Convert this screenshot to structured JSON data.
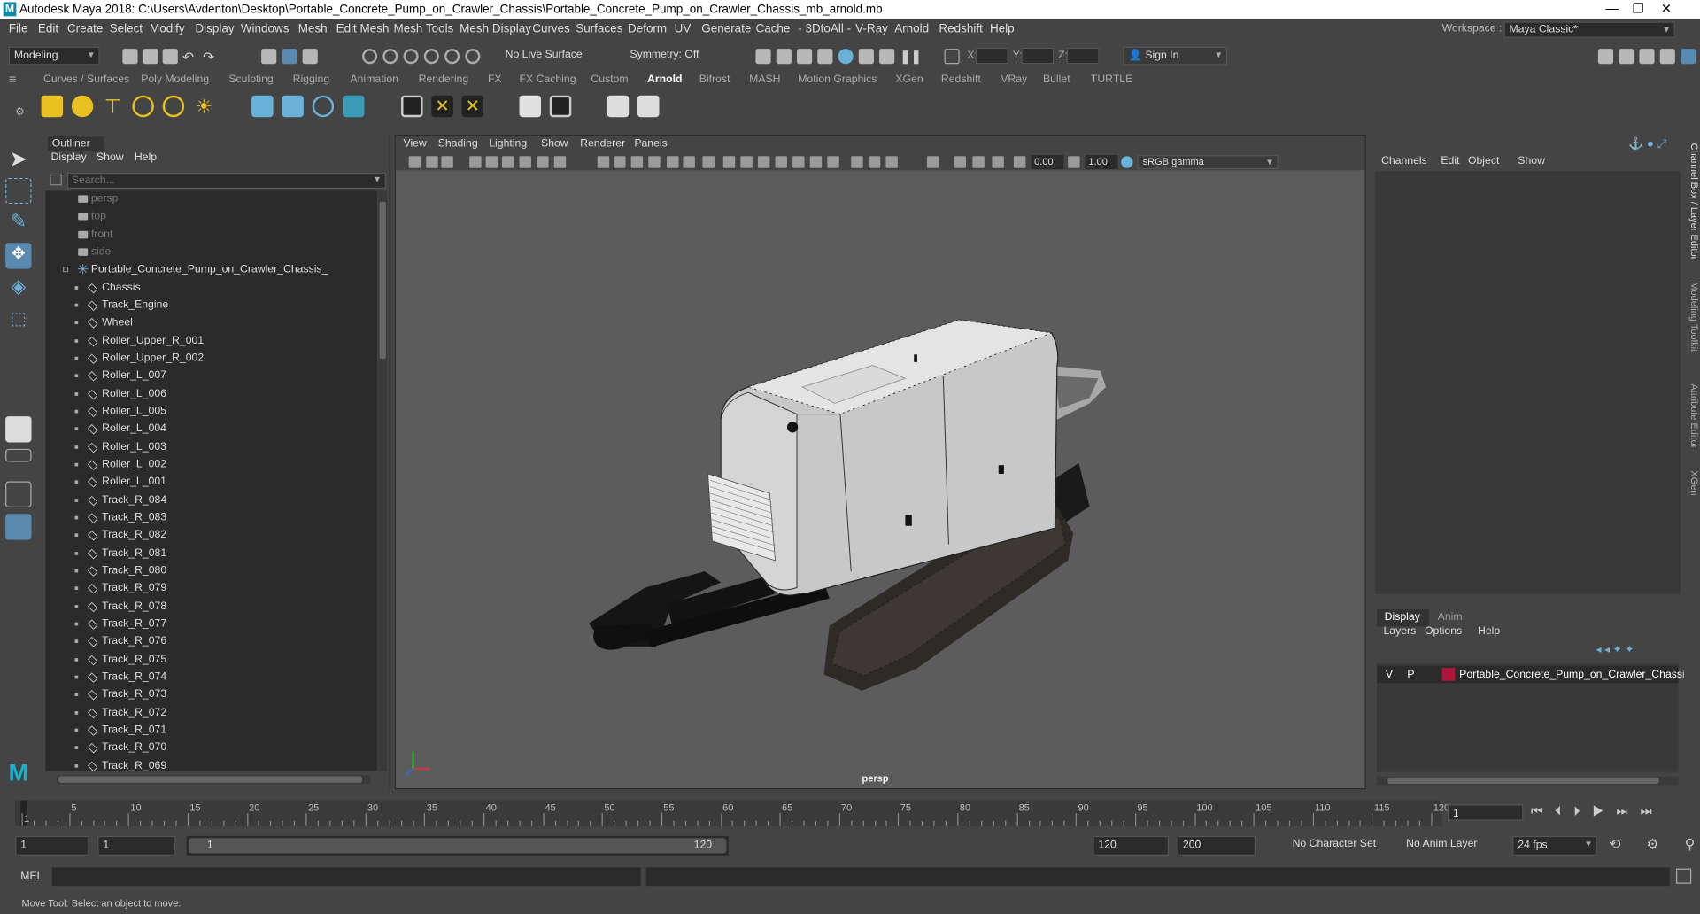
{
  "title_bar": {
    "title": "Autodesk Maya 2018: C:\\Users\\Avdenton\\Desktop\\Portable_Concrete_Pump_on_Crawler_Chassis\\Portable_Concrete_Pump_on_Crawler_Chassis_mb_arnold.mb",
    "minimize": "—",
    "maximize": "❐",
    "close": "✕"
  },
  "menu": [
    "File",
    "Edit",
    "Create",
    "Select",
    "Modify",
    "Display",
    "Windows",
    "Mesh",
    "Edit Mesh",
    "Mesh Tools",
    "Mesh Display",
    "Curves",
    "Surfaces",
    "Deform",
    "UV",
    "Generate",
    "Cache",
    "- 3DtoAll -",
    "V-Ray",
    "Arnold",
    "Redshift",
    "Help"
  ],
  "workspace": {
    "label": "Workspace :",
    "value": "Maya Classic*"
  },
  "status_line": {
    "mode": "Modeling",
    "live_surface": "No Live Surface",
    "symmetry": "Symmetry: Off",
    "x_label": "X:",
    "y_label": "Y:",
    "z_label": "Z:",
    "sign_in": "Sign In"
  },
  "shelf_tabs": [
    "Curves / Surfaces",
    "Poly Modeling",
    "Sculpting",
    "Rigging",
    "Animation",
    "Rendering",
    "FX",
    "FX Caching",
    "Custom",
    "Arnold",
    "Bifrost",
    "MASH",
    "Motion Graphics",
    "XGen",
    "Redshift",
    "VRay",
    "Bullet",
    "TURTLE"
  ],
  "shelf_active": "Arnold",
  "outliner": {
    "title": "Outliner",
    "menu": [
      "Display",
      "Show",
      "Help"
    ],
    "search_placeholder": "Search...",
    "cameras": [
      "persp",
      "top",
      "front",
      "side"
    ],
    "root": "Portable_Concrete_Pump_on_Crawler_Chassis_",
    "children": [
      "Chassis",
      "Track_Engine",
      "Wheel",
      "Roller_Upper_R_001",
      "Roller_Upper_R_002",
      "Roller_L_007",
      "Roller_L_006",
      "Roller_L_005",
      "Roller_L_004",
      "Roller_L_003",
      "Roller_L_002",
      "Roller_L_001",
      "Track_R_084",
      "Track_R_083",
      "Track_R_082",
      "Track_R_081",
      "Track_R_080",
      "Track_R_079",
      "Track_R_078",
      "Track_R_077",
      "Track_R_076",
      "Track_R_075",
      "Track_R_074",
      "Track_R_073",
      "Track_R_072",
      "Track_R_071",
      "Track_R_070",
      "Track_R_069"
    ]
  },
  "viewport": {
    "menu": [
      "View",
      "Shading",
      "Lighting",
      "Show",
      "Renderer",
      "Panels"
    ],
    "exposure": "0.00",
    "gamma": "1.00",
    "color_space": "sRGB gamma",
    "camera_label": "persp"
  },
  "channel_box": {
    "menu": [
      "Channels",
      "Edit",
      "Object",
      "Show"
    ],
    "tabs": [
      "Display",
      "Anim"
    ],
    "active_tab": "Display",
    "layer_menu": [
      "Layers",
      "Options",
      "Help"
    ],
    "layer": {
      "v": "V",
      "p": "P",
      "name": "Portable_Concrete_Pump_on_Crawler_Chassis",
      "color": "#b0143c"
    }
  },
  "side_tabs": [
    "Channel Box / Layer Editor",
    "Modeling Toolkit",
    "Attribute Editor",
    "XGen"
  ],
  "timeline": {
    "ticks": [
      "1",
      "5",
      "10",
      "15",
      "20",
      "25",
      "30",
      "35",
      "40",
      "45",
      "50",
      "55",
      "60",
      "65",
      "70",
      "75",
      "80",
      "85",
      "90",
      "95",
      "100",
      "105",
      "110",
      "115",
      "120"
    ],
    "current_frame": "1"
  },
  "range": {
    "start": "1",
    "anim_start": "1",
    "range_start": "1",
    "range_end": "120",
    "end": "120",
    "anim_end": "200",
    "character_set": "No Character Set",
    "anim_layer": "No Anim Layer",
    "fps": "24 fps"
  },
  "mel": {
    "label": "MEL"
  },
  "help_line": "Move Tool: Select an object to move."
}
